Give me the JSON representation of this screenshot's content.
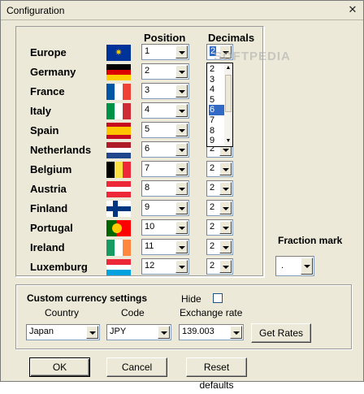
{
  "window": {
    "title": "Configuration",
    "close_glyph": "✕"
  },
  "headers": {
    "position": "Position",
    "decimals": "Decimals"
  },
  "rows": [
    {
      "country": "Europe",
      "flag": "eu",
      "position": "1",
      "decimals": "2"
    },
    {
      "country": "Germany",
      "flag": "de",
      "position": "2",
      "decimals": ""
    },
    {
      "country": "France",
      "flag": "fr",
      "position": "3",
      "decimals": ""
    },
    {
      "country": "Italy",
      "flag": "it",
      "position": "4",
      "decimals": ""
    },
    {
      "country": "Spain",
      "flag": "es",
      "position": "5",
      "decimals": ""
    },
    {
      "country": "Netherlands",
      "flag": "nl",
      "position": "6",
      "decimals": "2"
    },
    {
      "country": "Belgium",
      "flag": "be",
      "position": "7",
      "decimals": "2"
    },
    {
      "country": "Austria",
      "flag": "at",
      "position": "8",
      "decimals": "2"
    },
    {
      "country": "Finland",
      "flag": "fi",
      "position": "9",
      "decimals": "2"
    },
    {
      "country": "Portugal",
      "flag": "pt",
      "position": "10",
      "decimals": "2"
    },
    {
      "country": "Ireland",
      "flag": "ie",
      "position": "11",
      "decimals": "2"
    },
    {
      "country": "Luxemburg",
      "flag": "lu",
      "position": "12",
      "decimals": "2"
    }
  ],
  "decimals_dropdown": {
    "options": [
      "2",
      "3",
      "4",
      "5",
      "6",
      "7",
      "8",
      "9"
    ],
    "selected": "6"
  },
  "fraction_mark": {
    "label": "Fraction mark",
    "value": "."
  },
  "custom_currency": {
    "title": "Custom currency settings",
    "hide_label": "Hide",
    "hide_checked": false,
    "country_label": "Country",
    "code_label": "Code",
    "rate_label": "Exchange rate",
    "country_value": "Japan",
    "code_value": "JPY",
    "rate_value": "139.003",
    "get_rates_button": "Get Rates"
  },
  "buttons": {
    "ok": "OK",
    "cancel": "Cancel",
    "reset": "Reset defaults"
  },
  "watermark": "SOFTPEDIA",
  "colors": {
    "selection": "#316ac5",
    "window_bg": "#ece9d8"
  }
}
